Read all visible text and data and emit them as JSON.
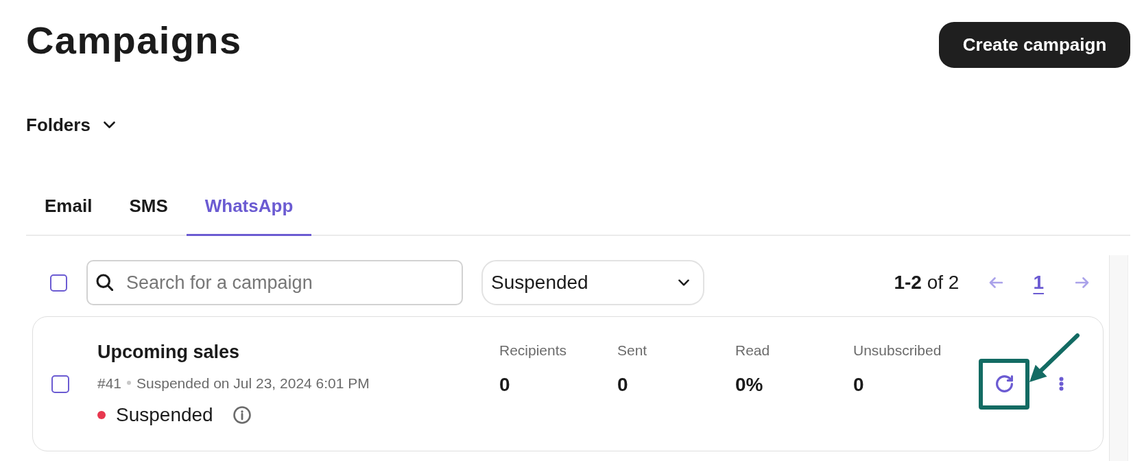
{
  "page": {
    "title": "Campaigns"
  },
  "create_button": {
    "label": "Create campaign"
  },
  "folders": {
    "label": "Folders",
    "expanded": false
  },
  "tabs": [
    {
      "label": "Email",
      "selected": false
    },
    {
      "label": "SMS",
      "selected": false
    },
    {
      "label": "WhatsApp",
      "selected": true
    }
  ],
  "toolbar": {
    "select_all": {
      "checked": false
    },
    "search": {
      "placeholder": "Search for a campaign"
    },
    "status_filter": {
      "value": "Suspended"
    }
  },
  "pagination": {
    "summary": "**1-2** of 2",
    "previous": {
      "disabled": true
    },
    "pages": [
      {
        "label": "1",
        "selected": true
      }
    ],
    "next": {
      "disabled": true
    }
  },
  "campaigns": [
    {
      "checked": false,
      "name": "Upcoming sales",
      "number": "#41",
      "date_text": "Suspended on Jul 23, 2024 6:01 PM",
      "status": {
        "label": "Suspended",
        "color": "#e8384f"
      },
      "stats": [
        {
          "label": "Recipients",
          "value": "0"
        },
        {
          "label": "Sent",
          "value": "0"
        },
        {
          "label": "Read",
          "value": "0%"
        },
        {
          "label": "Unsubscribed",
          "value": "0"
        }
      ],
      "refresh": {
        "highlighted": true
      }
    }
  ]
}
